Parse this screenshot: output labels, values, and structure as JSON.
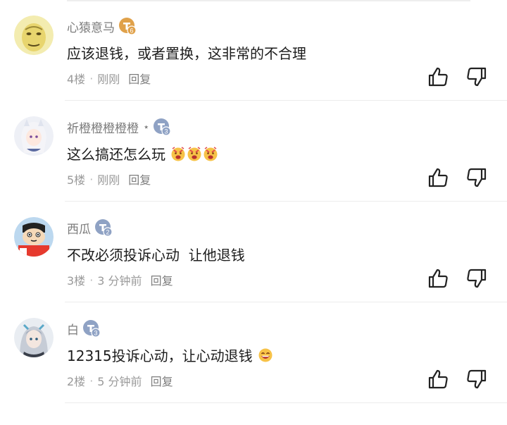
{
  "comments": [
    {
      "username": "心猿意马",
      "level": "6",
      "text": "应该退钱，或者置换，这非常的不合理",
      "floor": "4楼",
      "time": "刚刚",
      "reply_label": "回复"
    },
    {
      "username": "祈橙橙橙橙橙",
      "suffix": "⋆",
      "level": "3",
      "text": "这么搞还怎么玩",
      "floor": "5楼",
      "time": "刚刚",
      "reply_label": "回复"
    },
    {
      "username": "西瓜",
      "level": "2",
      "text": "不改必须投诉心动  让他退钱",
      "floor": "3楼",
      "time": "3 分钟前",
      "reply_label": "回复"
    },
    {
      "username": "白",
      "level": "3",
      "text": "12315投诉心动，让心动退钱",
      "floor": "2楼",
      "time": "5 分钟前",
      "reply_label": "回复"
    }
  ],
  "colors": {
    "badge_gold": "#e0a14a",
    "badge_blue": "#8fa2c4",
    "icon": "#222222",
    "meta_text": "#9a9a9a"
  },
  "icons": [
    "thumb-up-icon",
    "thumb-down-icon",
    "level-badge-icon",
    "emoji-icon"
  ]
}
